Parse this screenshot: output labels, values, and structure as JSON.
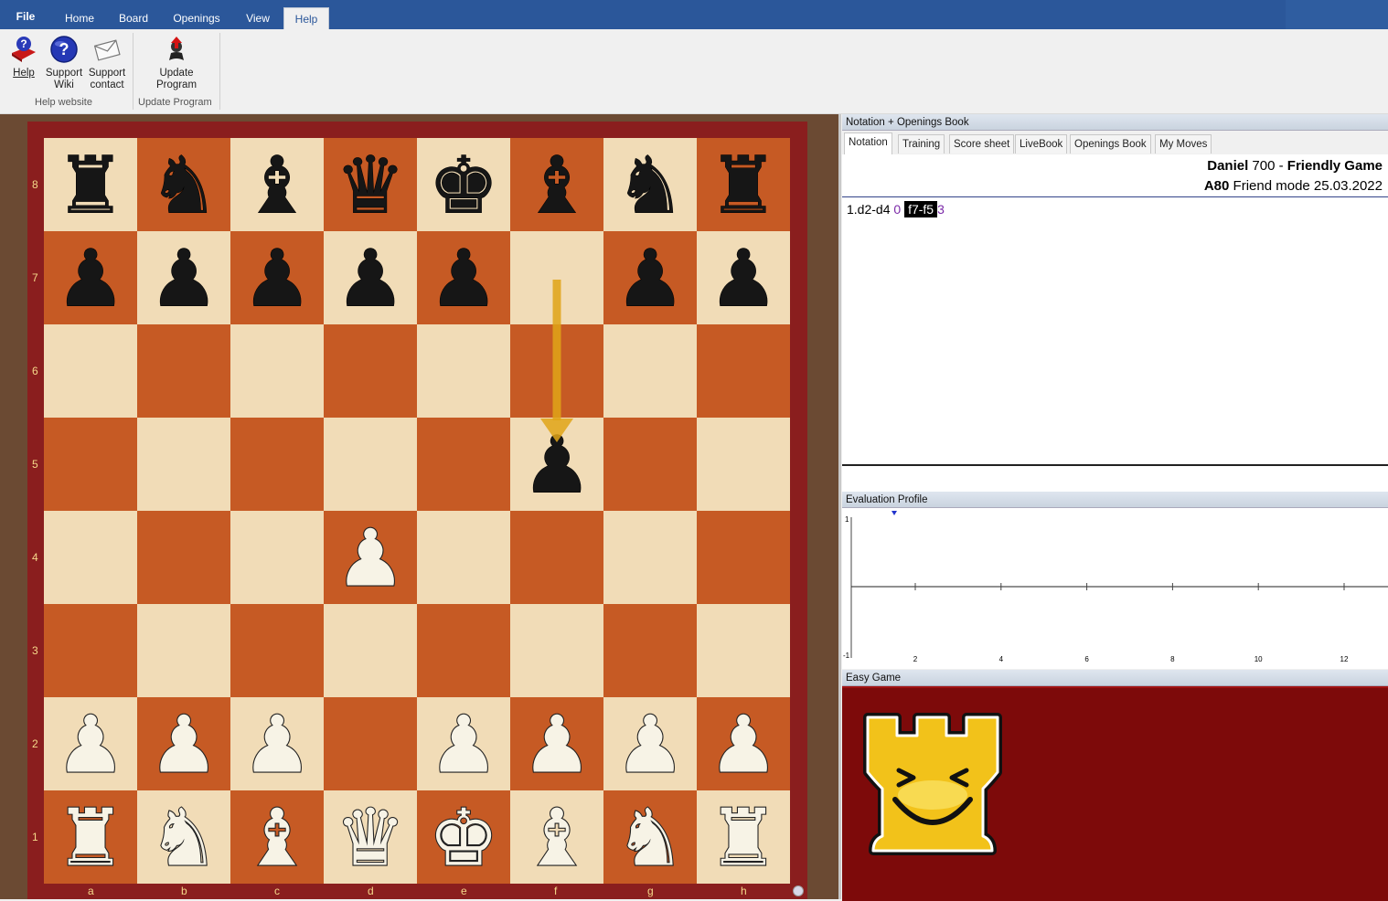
{
  "menu": {
    "file": "File",
    "tabs": [
      "Home",
      "Board",
      "Openings",
      "View",
      "Help"
    ],
    "active_tab": "Help"
  },
  "ribbon": {
    "groups": [
      {
        "label": "Help website",
        "buttons": [
          {
            "label_line1": "Help",
            "label_line2": "",
            "icon": "help-book-icon"
          },
          {
            "label_line1": "Support",
            "label_line2": "Wiki",
            "icon": "question-circle-icon"
          },
          {
            "label_line1": "Support",
            "label_line2": "contact",
            "icon": "envelope-icon"
          }
        ]
      },
      {
        "label": "Update Program",
        "buttons": [
          {
            "label_line1": "Update",
            "label_line2": "Program",
            "icon": "update-icon"
          }
        ]
      }
    ]
  },
  "board": {
    "files": [
      "a",
      "b",
      "c",
      "d",
      "e",
      "f",
      "g",
      "h"
    ],
    "ranks": [
      "8",
      "7",
      "6",
      "5",
      "4",
      "3",
      "2",
      "1"
    ],
    "light_square": "#f1dcb7",
    "dark_square": "#c65a24",
    "position": [
      [
        "r",
        "n",
        "b",
        "q",
        "k",
        "b",
        "n",
        "r"
      ],
      [
        "p",
        "p",
        "p",
        "p",
        "p",
        "",
        "p",
        "p"
      ],
      [
        "",
        "",
        "",
        "",
        "",
        "",
        "",
        ""
      ],
      [
        "",
        "",
        "",
        "",
        "",
        "p",
        "",
        ""
      ],
      [
        "",
        "",
        "",
        "P",
        "",
        "",
        "",
        ""
      ],
      [
        "",
        "",
        "",
        "",
        "",
        "",
        "",
        ""
      ],
      [
        "P",
        "P",
        "P",
        "",
        "P",
        "P",
        "P",
        "P"
      ],
      [
        "R",
        "N",
        "B",
        "Q",
        "K",
        "B",
        "N",
        "R"
      ]
    ],
    "last_move": {
      "from": "f7",
      "to": "f5",
      "arrow_color": "#e0a418"
    }
  },
  "notation_panel": {
    "title": "Notation + Openings Book",
    "tabs": [
      "Notation",
      "Training",
      "Score sheet",
      "LiveBook",
      "Openings Book",
      "My Moves"
    ],
    "active_tab": "Notation",
    "game": {
      "white_player": "Daniel",
      "white_rating": "700",
      "separator": "-",
      "event": "Friendly Game",
      "eco": "A80",
      "mode_date": "Friend mode 25.03.2022"
    },
    "moves": [
      {
        "text": "1.d2-d4",
        "eval": "0",
        "current": false
      },
      {
        "text": "f7-f5",
        "eval": "3",
        "current": true
      }
    ]
  },
  "evaluation_panel": {
    "title": "Evaluation Profile",
    "y_top": "1",
    "y_bottom": "-1",
    "x_ticks": [
      "2",
      "4",
      "6",
      "8",
      "10",
      "12"
    ]
  },
  "easy_game_panel": {
    "title": "Easy Game",
    "mascot_icon": "smiling-rook-icon",
    "background": "#7d0a0a"
  }
}
